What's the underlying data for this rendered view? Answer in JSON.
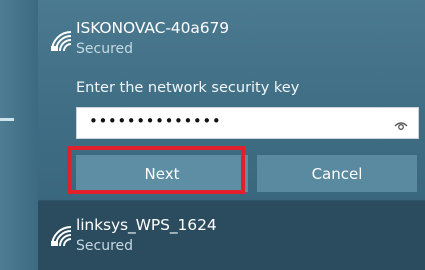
{
  "networks": [
    {
      "name": "ISKONOVAC-40a679",
      "status": "Secured",
      "icon": "wifi-secured-icon"
    },
    {
      "name": "linksys_WPS_1624",
      "status": "Secured",
      "icon": "wifi-secured-icon"
    }
  ],
  "connect_form": {
    "prompt": "Enter the network security key",
    "password_mask": "••••••••••••••",
    "reveal_icon": "eye-icon",
    "next_label": "Next",
    "cancel_label": "Cancel"
  },
  "colors": {
    "panel_bg": "#2b4b5e",
    "selected_bg": "#436f86",
    "button_bg": "#5a8aa0",
    "highlight_border": "#e0202a"
  }
}
